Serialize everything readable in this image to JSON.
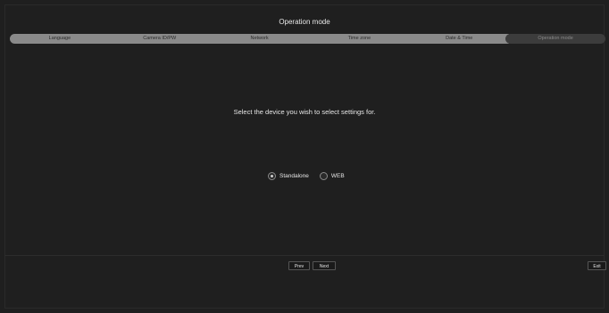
{
  "header": {
    "title": "Operation mode"
  },
  "steps": [
    {
      "label": "Language",
      "active": false
    },
    {
      "label": "Camera ID/PW",
      "active": false
    },
    {
      "label": "Network",
      "active": false
    },
    {
      "label": "Time zone",
      "active": false
    },
    {
      "label": "Date & Time",
      "active": false
    },
    {
      "label": "Operation mode",
      "active": true
    }
  ],
  "main": {
    "prompt": "Select the device you wish to select settings for.",
    "options": [
      {
        "label": "Standalone",
        "selected": true
      },
      {
        "label": "WEB",
        "selected": false
      }
    ]
  },
  "footer": {
    "prev_label": "Prev",
    "next_label": "Next",
    "exit_label": "Exit"
  },
  "colors": {
    "background": "#1f1f1f",
    "step_inactive": "#8a8a8a",
    "step_active": "#3c3c3c",
    "text": "#e6e6e6"
  }
}
